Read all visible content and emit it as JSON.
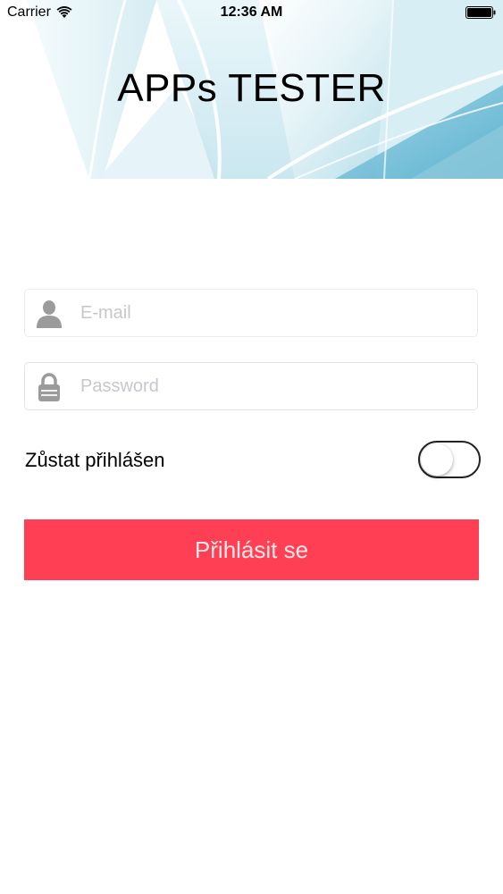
{
  "status_bar": {
    "carrier": "Carrier",
    "time": "12:36 AM",
    "wifi_icon": "wifi-icon",
    "battery_icon": "battery-icon"
  },
  "header": {
    "title": "APPs TESTER"
  },
  "form": {
    "email": {
      "placeholder": "E-mail",
      "value": "",
      "icon": "user-icon"
    },
    "password": {
      "placeholder": "Password",
      "value": "",
      "icon": "lock-icon"
    },
    "remember": {
      "label": "Zůstat přihlášen",
      "checked": false
    },
    "submit_label": "Přihlásit se"
  },
  "colors": {
    "accent": "#ff4054",
    "banner_blue": "#5fb7d3",
    "icon_gray": "#9b9b9b"
  }
}
